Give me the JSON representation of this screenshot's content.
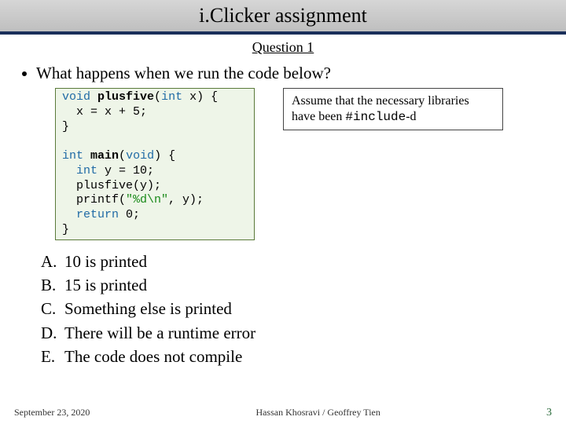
{
  "title": "i.Clicker assignment",
  "question_number": "Question 1",
  "question_text": "What happens when we run the code below?",
  "code_block1": {
    "l1_kw1": "void",
    "l1_fn": "plusfive",
    "l1_kw2": "int",
    "l1_rest": " x) {",
    "l2": "  x = x + 5;",
    "l3": "}"
  },
  "code_block2": {
    "l1_kw1": "int",
    "l1_fn": "main",
    "l1_kw2": "void",
    "l1_rest": ") {",
    "l2_kw": "int",
    "l2_rest": " y = 10;",
    "l3": "  plusfive(y);",
    "l4_pre": "  printf(",
    "l4_str": "\"%d\\n\"",
    "l4_post": ", y);",
    "l5_kw": "return",
    "l5_rest": " 0;",
    "l6": "}"
  },
  "note": {
    "pre": "Assume that the necessary libraries have been ",
    "mono": "#include",
    "post": "-d"
  },
  "answers": [
    {
      "label": "A.",
      "text": "10 is printed"
    },
    {
      "label": "B.",
      "text": "15 is printed"
    },
    {
      "label": "C.",
      "text": "Something else is printed"
    },
    {
      "label": "D.",
      "text": "There will be a runtime error"
    },
    {
      "label": "E.",
      "text": "The  code does not compile"
    }
  ],
  "footer": {
    "date": "September 23, 2020",
    "authors": "Hassan Khosravi / Geoffrey Tien",
    "page": "3"
  }
}
